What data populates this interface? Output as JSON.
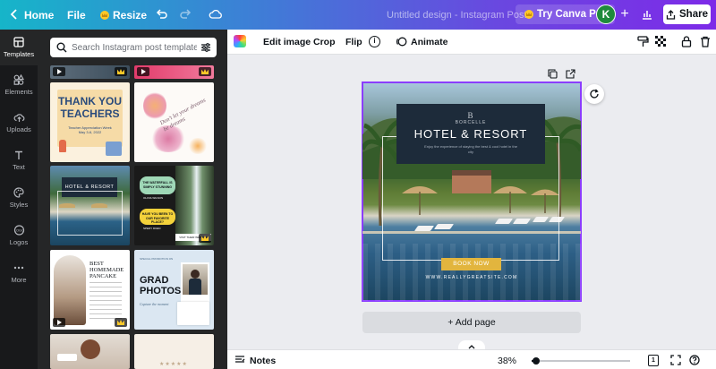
{
  "topbar": {
    "home_label": "Home",
    "file_label": "File",
    "resize_label": "Resize",
    "document_title": "Untitled design - Instagram Post",
    "try_pro_label": "Try Canva Pro",
    "avatar_initial": "K",
    "share_label": "Share"
  },
  "rail": {
    "items": [
      {
        "label": "Templates",
        "icon": "templates-icon",
        "active": true
      },
      {
        "label": "Elements",
        "icon": "elements-icon"
      },
      {
        "label": "Uploads",
        "icon": "upload-cloud-icon"
      },
      {
        "label": "Text",
        "icon": "text-icon"
      },
      {
        "label": "Styles",
        "icon": "palette-icon"
      },
      {
        "label": "Logos",
        "icon": "logos-icon"
      },
      {
        "label": "More",
        "icon": "more-icon"
      }
    ]
  },
  "panel": {
    "search_placeholder": "Search Instagram post templates",
    "templates": [
      {
        "t1": "THANK YOU",
        "t2": "TEACHERS",
        "t3": "Teacher Appreciation Week",
        "t4": "May 3-6, 2022"
      },
      {
        "t1": "Don't let your dreams be dreams"
      },
      {
        "t1": "HOTEL & RESORT"
      },
      {
        "t1": "THE WATERFALL IS SIMPLY STUNNING",
        "t2": "OLIVIA WILSON",
        "t3": "HAVE YOU BEEN TO OUR FAVORITE PLACE?",
        "t4": "SPEDY DUEN",
        "t5": "VISIT THEIR WEBSITE"
      },
      {
        "t1": "BEST",
        "t2": "HOMEMADE",
        "t3": "PANCAKE"
      },
      {
        "t1": "SPECIAL PROMOTION ON",
        "t2": "GRAD",
        "t3": "PHOTOS",
        "t4": "Capture the moment"
      }
    ]
  },
  "toolbar": {
    "edit_image": "Edit image",
    "crop": "Crop",
    "flip": "Flip",
    "animate": "Animate"
  },
  "design": {
    "brand": "BORCELLE",
    "logo_glyph": "B",
    "title": "HOTEL & RESORT",
    "subtitle": "Enjoy the experience of staying the best & cool hotel in the city",
    "button": "BOOK NOW",
    "website": "WWW.REALLYGREATSITE.COM"
  },
  "canvas": {
    "add_page_label": "+ Add page"
  },
  "statusbar": {
    "notes_label": "Notes",
    "zoom": "38%",
    "zoom_fraction": 0.03,
    "page_count": "1"
  }
}
